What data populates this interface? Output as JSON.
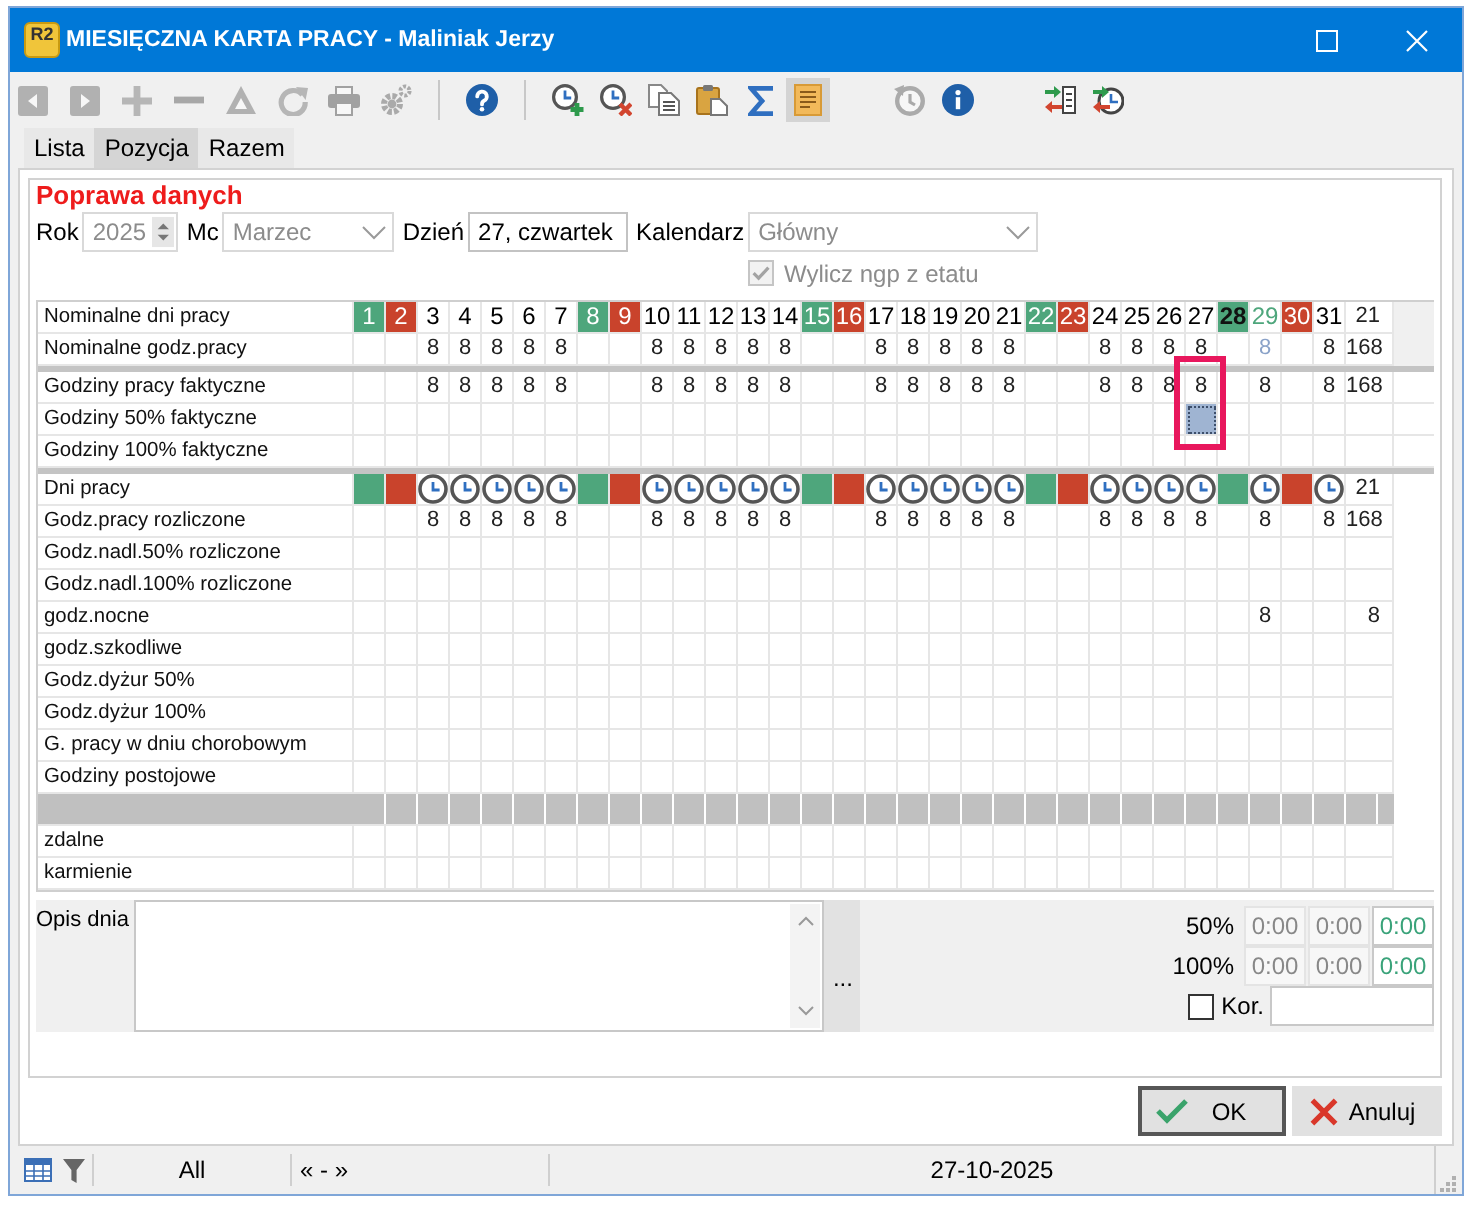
{
  "window": {
    "title": "MIESIĘCZNA KARTA PRACY - Maliniak Jerzy",
    "app_icon_text": "R2"
  },
  "toolbar": [
    [
      {
        "disabled": true,
        "selected": false
      },
      {
        "disabled": true,
        "selected": false
      },
      {
        "disabled": true,
        "selected": false
      },
      {
        "disabled": true,
        "selected": false
      },
      {
        "disabled": true,
        "selected": false
      },
      {
        "disabled": true,
        "selected": false
      },
      {
        "disabled": true,
        "selected": false
      },
      {
        "disabled": true,
        "selected": false
      }
    ],
    [
      {
        "disabled": false,
        "selected": false
      }
    ],
    [
      {
        "disabled": false,
        "selected": false
      },
      {
        "disabled": false,
        "selected": false
      },
      {
        "disabled": false,
        "selected": false
      },
      {
        "disabled": false,
        "selected": false
      },
      {
        "disabled": false,
        "selected": false
      },
      {
        "disabled": false,
        "selected": true
      }
    ],
    [
      {
        "disabled": true,
        "selected": false
      },
      {
        "disabled": false,
        "selected": false
      }
    ],
    [
      {
        "disabled": false,
        "selected": false
      },
      {
        "disabled": false,
        "selected": false
      }
    ]
  ],
  "tabs": [
    {
      "label": "Lista",
      "selected": false
    },
    {
      "label": "Pozycja",
      "selected": true
    },
    {
      "label": "Razem",
      "selected": false
    }
  ],
  "form": {
    "heading": "Poprawa danych",
    "fields": [
      {
        "kind": "spin",
        "label": "Rok",
        "value": "2025",
        "disabled": true
      },
      {
        "kind": "combo",
        "label": "Mc",
        "value": "Marzec",
        "disabled": true
      },
      {
        "kind": "text",
        "label": "Dzień",
        "value": "27, czwartek",
        "disabled": false
      },
      {
        "kind": "combo",
        "label": "Kalendarz",
        "value": "Główny",
        "disabled": true
      }
    ],
    "checkbox": {
      "label": "Wylicz ngp z etatu",
      "checked": true,
      "disabled": true
    }
  },
  "grid": {
    "days": [
      {
        "label": "1",
        "kind": "free"
      },
      {
        "label": "2",
        "kind": "sunday"
      },
      {
        "label": "3",
        "kind": "workday"
      },
      {
        "label": "4",
        "kind": "workday"
      },
      {
        "label": "5",
        "kind": "workday"
      },
      {
        "label": "6",
        "kind": "workday"
      },
      {
        "label": "7",
        "kind": "workday"
      },
      {
        "label": "8",
        "kind": "free"
      },
      {
        "label": "9",
        "kind": "sunday"
      },
      {
        "label": "10",
        "kind": "workday"
      },
      {
        "label": "11",
        "kind": "workday"
      },
      {
        "label": "12",
        "kind": "workday"
      },
      {
        "label": "13",
        "kind": "workday"
      },
      {
        "label": "14",
        "kind": "workday"
      },
      {
        "label": "15",
        "kind": "free"
      },
      {
        "label": "16",
        "kind": "sunday"
      },
      {
        "label": "17",
        "kind": "workday"
      },
      {
        "label": "18",
        "kind": "workday"
      },
      {
        "label": "19",
        "kind": "workday"
      },
      {
        "label": "20",
        "kind": "workday"
      },
      {
        "label": "21",
        "kind": "workday"
      },
      {
        "label": "22",
        "kind": "free"
      },
      {
        "label": "23",
        "kind": "sunday"
      },
      {
        "label": "24",
        "kind": "workday"
      },
      {
        "label": "25",
        "kind": "workday"
      },
      {
        "label": "26",
        "kind": "workday"
      },
      {
        "label": "27",
        "kind": "workday"
      },
      {
        "label": "28",
        "kind": "free-swapped"
      },
      {
        "label": "29",
        "kind": "workday-swapped"
      },
      {
        "label": "30",
        "kind": "sunday"
      },
      {
        "label": "31",
        "kind": "workday"
      }
    ],
    "sections": [
      {
        "kind": "nominal",
        "rows": [
          {
            "kind": "day-numbers",
            "label": "Nominalne dni pracy",
            "total": "21"
          },
          {
            "kind": "nominal-hours",
            "label": "Nominalne godz.pracy",
            "cells": [
              null,
              null,
              "8",
              "8",
              "8",
              "8",
              "8",
              null,
              null,
              "8",
              "8",
              "8",
              "8",
              "8",
              null,
              null,
              "8",
              "8",
              "8",
              "8",
              "8",
              null,
              null,
              "8",
              "8",
              "8",
              "8",
              null,
              "8",
              null,
              "8"
            ],
            "total": "168"
          }
        ]
      },
      {
        "kind": "actual",
        "highlight_frame": true,
        "rows": [
          {
            "kind": "hours",
            "label": "Godziny pracy faktyczne",
            "cells": [
              null,
              null,
              "8",
              "8",
              "8",
              "8",
              "8",
              null,
              null,
              "8",
              "8",
              "8",
              "8",
              "8",
              null,
              null,
              "8",
              "8",
              "8",
              "8",
              "8",
              null,
              null,
              "8",
              "8",
              "8",
              "8",
              null,
              "8",
              null,
              "8"
            ],
            "total": "168"
          },
          {
            "kind": "hours",
            "label": "Godziny 50% faktyczne",
            "cells": [
              null,
              null,
              null,
              null,
              null,
              null,
              null,
              null,
              null,
              null,
              null,
              null,
              null,
              null,
              null,
              null,
              null,
              null,
              null,
              null,
              null,
              null,
              null,
              null,
              null,
              null,
              {
                "selected": true
              },
              null,
              null,
              null,
              null
            ]
          },
          {
            "kind": "hours",
            "label": "Godziny 100% faktyczne"
          }
        ]
      },
      {
        "kind": "settled",
        "rows": [
          {
            "kind": "day-marks",
            "label": "Dni pracy",
            "total": "21"
          },
          {
            "kind": "hours",
            "label": "Godz.pracy rozliczone",
            "cells": [
              null,
              null,
              "8",
              "8",
              "8",
              "8",
              "8",
              null,
              null,
              "8",
              "8",
              "8",
              "8",
              "8",
              null,
              null,
              "8",
              "8",
              "8",
              "8",
              "8",
              null,
              null,
              "8",
              "8",
              "8",
              "8",
              null,
              "8",
              null,
              "8"
            ],
            "total": "168"
          },
          {
            "kind": "hours",
            "label": "Godz.nadl.50% rozliczone"
          },
          {
            "kind": "hours",
            "label": "Godz.nadl.100% rozliczone"
          },
          {
            "kind": "hours",
            "label": "godz.nocne",
            "cells": [
              null,
              null,
              null,
              null,
              null,
              null,
              null,
              null,
              null,
              null,
              null,
              null,
              null,
              null,
              null,
              null,
              null,
              null,
              null,
              null,
              null,
              null,
              null,
              null,
              null,
              null,
              null,
              null,
              "8",
              null,
              null
            ],
            "total": "8"
          },
          {
            "kind": "hours",
            "label": "godz.szkodliwe"
          },
          {
            "kind": "hours",
            "label": "Godz.dyżur 50%"
          },
          {
            "kind": "hours",
            "label": "Godz.dyżur 100%"
          },
          {
            "kind": "hours",
            "label": "G. pracy w dniu chorobowym"
          },
          {
            "kind": "hours",
            "label": "Godziny postojowe"
          },
          {
            "kind": "separator"
          },
          {
            "kind": "hours",
            "label": "zdalne"
          },
          {
            "kind": "hours",
            "label": "karmienie"
          }
        ]
      }
    ]
  },
  "day_details": {
    "label": "Opis dnia",
    "more_button": "...",
    "overtime": [
      {
        "label": "50%",
        "values": [
          {
            "text": "0:00",
            "editable": false
          },
          {
            "text": "0:00",
            "editable": false
          },
          {
            "text": "0:00",
            "editable": true
          }
        ]
      },
      {
        "label": "100%",
        "values": [
          {
            "text": "0:00",
            "editable": false
          },
          {
            "text": "0:00",
            "editable": false
          },
          {
            "text": "0:00",
            "editable": true
          }
        ]
      }
    ],
    "correction": {
      "label": "Kor.",
      "checked": false
    }
  },
  "buttons": [
    {
      "kind": "ok",
      "label": "OK",
      "default": true
    },
    {
      "kind": "cancel",
      "label": "Anuluj",
      "default": false
    }
  ],
  "status_bar": {
    "filter": "All",
    "range": "« - »",
    "date": "27-10-2025"
  }
}
